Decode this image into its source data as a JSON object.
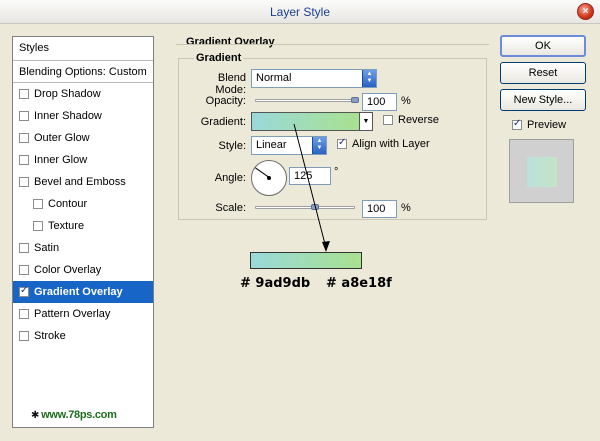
{
  "window": {
    "title": "Layer Style",
    "close_glyph": "×"
  },
  "sidebar": {
    "header": "Styles",
    "blending": "Blending Options: Custom",
    "items": [
      {
        "label": "Drop Shadow",
        "checked": false,
        "indent": false,
        "selected": false
      },
      {
        "label": "Inner Shadow",
        "checked": false,
        "indent": false,
        "selected": false
      },
      {
        "label": "Outer Glow",
        "checked": false,
        "indent": false,
        "selected": false
      },
      {
        "label": "Inner Glow",
        "checked": false,
        "indent": false,
        "selected": false
      },
      {
        "label": "Bevel and Emboss",
        "checked": false,
        "indent": false,
        "selected": false
      },
      {
        "label": "Contour",
        "checked": false,
        "indent": true,
        "selected": false
      },
      {
        "label": "Texture",
        "checked": false,
        "indent": true,
        "selected": false
      },
      {
        "label": "Satin",
        "checked": false,
        "indent": false,
        "selected": false
      },
      {
        "label": "Color Overlay",
        "checked": false,
        "indent": false,
        "selected": false
      },
      {
        "label": "Gradient Overlay",
        "checked": true,
        "indent": false,
        "selected": true
      },
      {
        "label": "Pattern Overlay",
        "checked": false,
        "indent": false,
        "selected": false
      },
      {
        "label": "Stroke",
        "checked": false,
        "indent": false,
        "selected": false
      }
    ],
    "watermark": "www.78ps.com"
  },
  "panel": {
    "section_title": "Gradient Overlay",
    "group_title": "Gradient",
    "blend_mode": {
      "label": "Blend Mode:",
      "value": "Normal"
    },
    "opacity": {
      "label": "Opacity:",
      "value": "100",
      "unit": "%",
      "level": 1.0
    },
    "gradient": {
      "label": "Gradient:",
      "reverse_label": "Reverse",
      "reverse_checked": false
    },
    "style": {
      "label": "Style:",
      "value": "Linear",
      "align_label": "Align with Layer",
      "align_checked": true
    },
    "angle": {
      "label": "Angle:",
      "value": "125",
      "unit": "°"
    },
    "scale": {
      "label": "Scale:",
      "value": "100",
      "unit": "%",
      "level": 0.4
    }
  },
  "annotation": {
    "color_start": "# 9ad9db",
    "color_end": "# a8e18f",
    "start_hex": "#9ad9db",
    "end_hex": "#a8e18f"
  },
  "buttons": {
    "ok": "OK",
    "reset": "Reset",
    "new_style": "New Style...",
    "preview": "Preview",
    "preview_checked": true
  }
}
